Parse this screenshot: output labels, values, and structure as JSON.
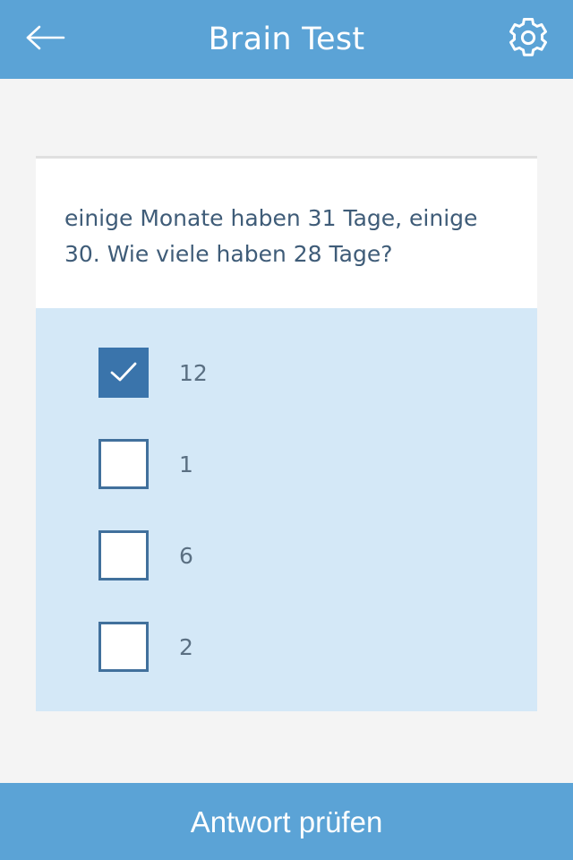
{
  "header": {
    "title": "Brain Test",
    "back_icon": "arrow-left-icon",
    "settings_icon": "gear-icon",
    "background_color": "#5ba3d6",
    "text_color": "#ffffff"
  },
  "quiz": {
    "question": "einige Monate haben 31 Tage, einige 30. Wie viele haben 28 Tage?",
    "question_color": "#3f5c78",
    "answers_background": "#d4e8f7",
    "checked_color": "#3a74ab",
    "checkbox_border_color": "#41709c",
    "options": [
      {
        "label": "12",
        "checked": true
      },
      {
        "label": "1",
        "checked": false
      },
      {
        "label": "6",
        "checked": false
      },
      {
        "label": "2",
        "checked": false
      }
    ]
  },
  "footer": {
    "submit_label": "Antwort prüfen",
    "background_color": "#5ba3d6"
  },
  "page": {
    "background_color": "#f4f4f4"
  }
}
